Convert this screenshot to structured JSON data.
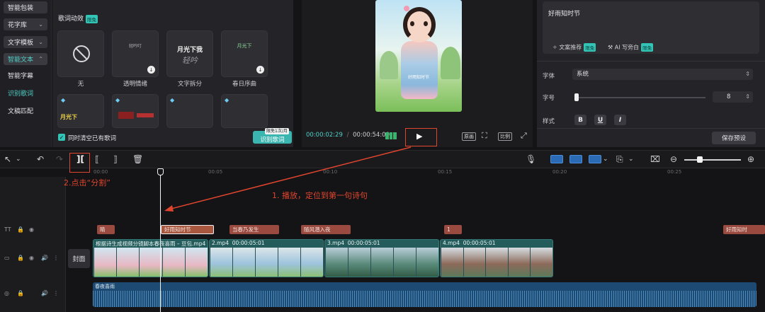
{
  "left_nav": {
    "items": [
      {
        "label": "智能包装",
        "chevron": ""
      },
      {
        "label": "花字库",
        "chevron": "⌄"
      },
      {
        "label": "文字模板",
        "chevron": "⌄"
      },
      {
        "label": "智能文本",
        "chevron": "⌃"
      }
    ],
    "sub_items": [
      "智能字幕",
      "识别歌词",
      "文稿匹配"
    ]
  },
  "lyric_effects": {
    "title": "歌词动效",
    "badge": "限免",
    "cards": [
      {
        "label": "无",
        "preview": "",
        "preview2": ""
      },
      {
        "label": "透明情绪",
        "preview": "轻吟叮",
        "preview2": ""
      },
      {
        "label": "文字拆分",
        "preview": "月光下我",
        "preview2": "轻吟"
      },
      {
        "label": "春日序曲",
        "preview": "月光下",
        "preview2": ""
      }
    ],
    "row2_texts": [
      "月光下",
      "",
      "",
      ""
    ],
    "clear_existing_label": "同时清空已有歌词",
    "recognize_button": "识别歌词",
    "limit_badge": "限免1次/月"
  },
  "preview": {
    "current_time": "00:00:02:29",
    "total_time": "00:00:54:00",
    "buttons": [
      "原画",
      "比例"
    ],
    "caption_in_video": "好雨知时节"
  },
  "right_panel": {
    "text_value": "好雨知时节",
    "text_recommend": "文案推荐",
    "text_recommend_badge": "限免",
    "ai_write": "AI 写旁白",
    "ai_badge": "限免",
    "font_label": "字体",
    "font_value": "系统",
    "size_label": "字号",
    "size_value": "8",
    "style_label": "样式",
    "style_buttons": [
      "B",
      "U",
      "I"
    ],
    "save_preset": "保存预设"
  },
  "annotations": {
    "split_hint": "2.点击“分割”",
    "play_hint": "1. 播放，定位到第一句诗句"
  },
  "ruler_labels": [
    "00:00",
    "00:05",
    "00:10",
    "00:15",
    "00:20",
    "00:25"
  ],
  "lyric_track": [
    "睛",
    "好雨知时节",
    "当春乃发生",
    "随风潜入夜",
    "1",
    "好雨知时"
  ],
  "video_track": {
    "cover_label": "封面",
    "clips": [
      {
        "name": "根据诗生成视频分镜脚本春夜喜雨 – 豆包.mp4",
        "duration": ""
      },
      {
        "name": "2.mp4",
        "duration": "00:00:05:01"
      },
      {
        "name": "3.mp4",
        "duration": "00:00:05:01"
      },
      {
        "name": "4.mp4",
        "duration": "00:00:05:01"
      }
    ]
  },
  "audio_track": {
    "name": "春夜喜雨"
  },
  "colors": {
    "accent": "#4fd0c8",
    "annotation": "#e0452e",
    "lyric_clip": "#9a4a3e",
    "video_clip": "#2b6a6a",
    "audio_clip": "#1f4f7a"
  }
}
